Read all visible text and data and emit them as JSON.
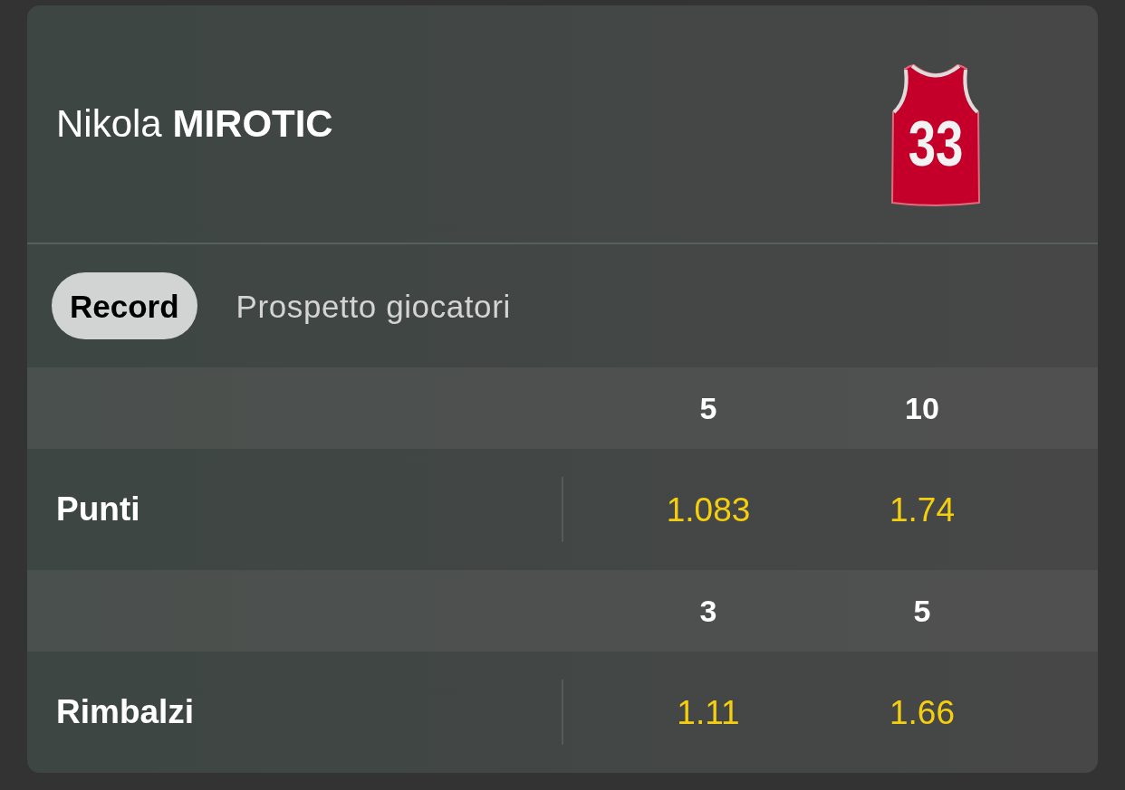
{
  "player": {
    "name": "Nikola **MIROTIC**",
    "jersey_number": "33"
  },
  "tabs": [
    {
      "label": "Record",
      "selected": true
    },
    {
      "label": "Prospetto giocatori",
      "selected": false
    }
  ],
  "markets": [
    {
      "lines": [
        "5",
        "10"
      ],
      "label": "Punti",
      "odds": [
        "1.083",
        "1.74"
      ]
    },
    {
      "lines": [
        "3",
        "5"
      ],
      "label": "Rimbalzi",
      "odds": [
        "1.11",
        "1.66"
      ]
    }
  ]
}
